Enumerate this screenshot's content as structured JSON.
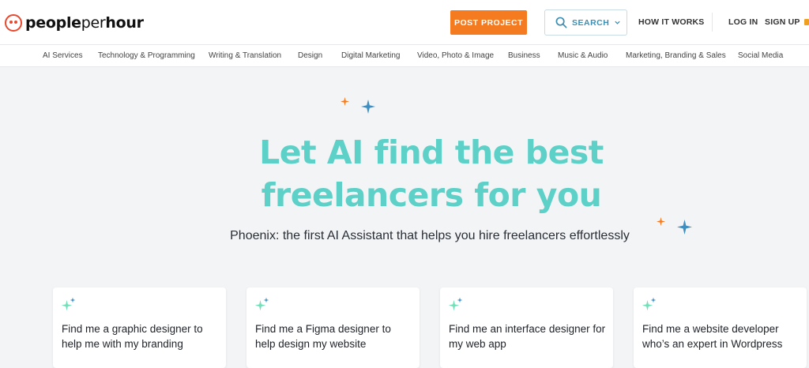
{
  "brand": {
    "name_bold": "people",
    "name_light": "per",
    "name_bold2": "hour"
  },
  "header": {
    "post_project": "POST PROJECT",
    "search": "SEARCH",
    "how_it_works": "HOW IT WORKS",
    "log_in": "LOG IN",
    "sign_up": "SIGN UP"
  },
  "categories": [
    "AI Services",
    "Technology & Programming",
    "Writing & Translation",
    "Design",
    "Digital Marketing",
    "Video, Photo & Image",
    "Business",
    "Music & Audio",
    "Marketing, Branding & Sales",
    "Social Media"
  ],
  "hero": {
    "title_line1": "Let AI find the best",
    "title_line2": "freelancers for you",
    "subtitle": "Phoenix: the first AI Assistant that helps you hire freelancers effortlessly"
  },
  "cards": [
    {
      "text": "Find me a graphic designer to help me with my branding"
    },
    {
      "text": "Find me a Figma designer to help design my website"
    },
    {
      "text": "Find me an interface designer for my web app"
    },
    {
      "text": "Find me a website developer who’s an expert in Wordpress"
    }
  ],
  "colors": {
    "accent_orange": "#f47b20",
    "hero_teal": "#5dd0c7",
    "search_blue": "#3b8fb3",
    "spark_blue": "#3d8fc2"
  },
  "icons": {
    "search": "search-icon",
    "chevron": "chevron-down-icon",
    "sparkle": "sparkle-icon"
  }
}
